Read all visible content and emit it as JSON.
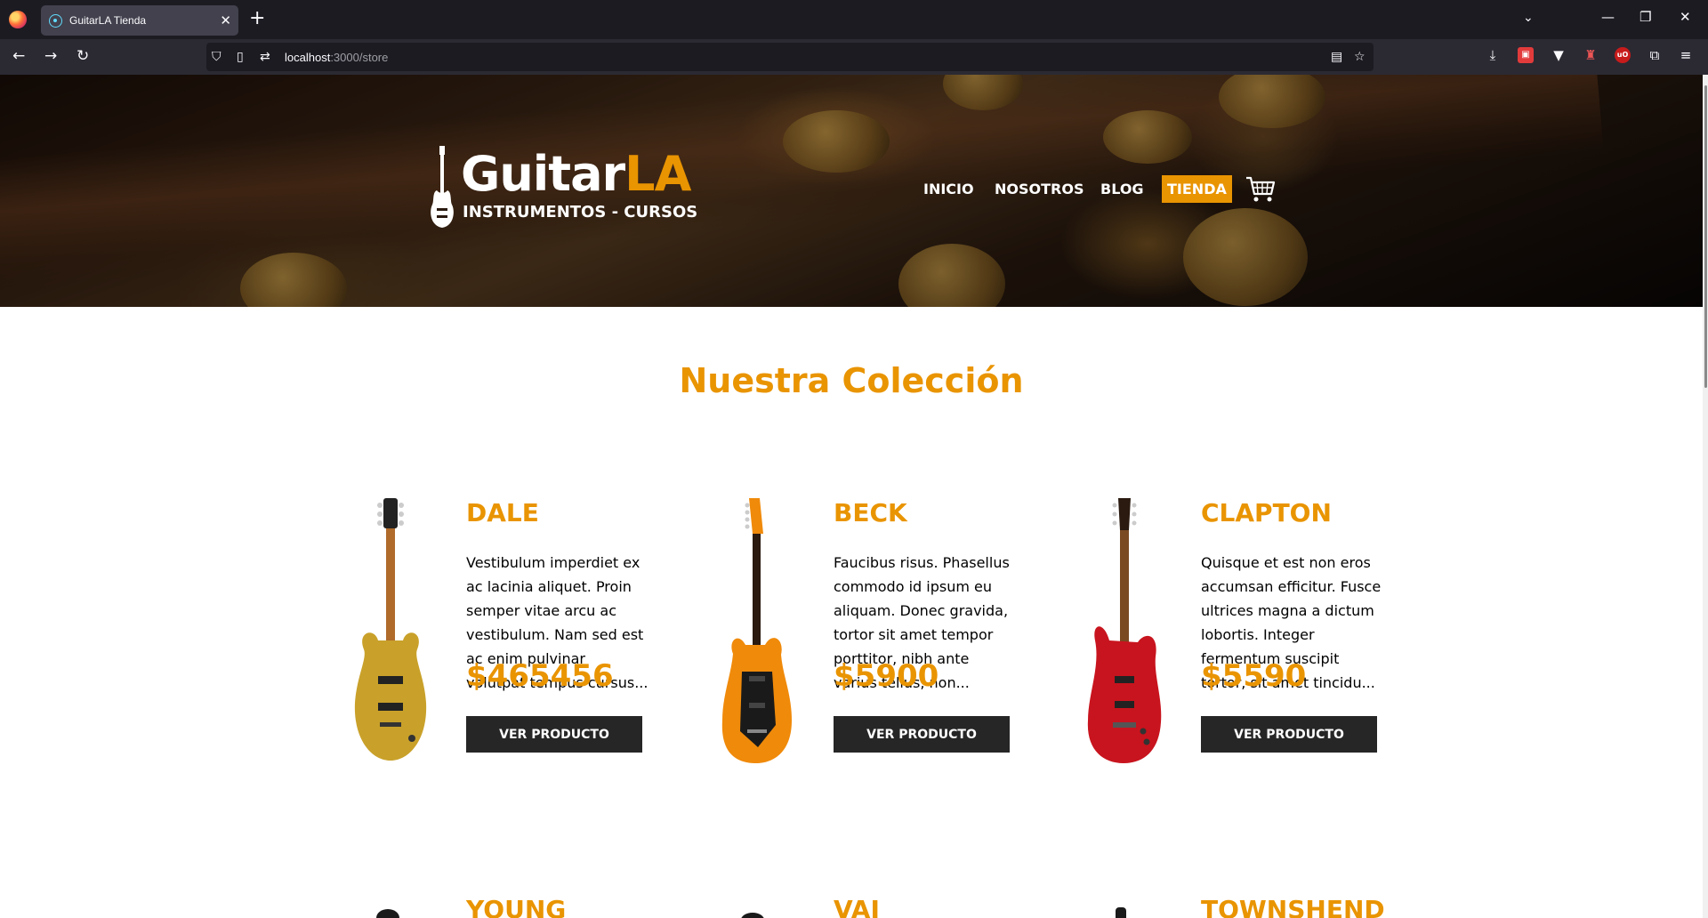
{
  "browser": {
    "tab_title": "GuitarLA Tienda",
    "url_host": "localhost",
    "url_path": ":3000/store"
  },
  "header": {
    "logo_main": "Guitar",
    "logo_accent": "LA",
    "logo_sub": "INSTRUMENTOS - CURSOS",
    "nav": [
      "INICIO",
      "NOSOTROS",
      "BLOG",
      "TIENDA"
    ],
    "active_nav": "TIENDA"
  },
  "main": {
    "title": "Nuestra Colección",
    "products": [
      {
        "name": "DALE",
        "description": "Vestibulum imperdiet ex ac lacinia aliquet. Proin semper vitae arcu ac vestibulum. Nam sed est ac enim pulvinar volutpat tempus cursus...",
        "price": "$465456",
        "button": "VER PRODUCTO",
        "color": "#c9a12a"
      },
      {
        "name": "BECK",
        "description": "Faucibus risus. Phasellus commodo id ipsum eu aliquam. Donec gravida, tortor sit amet tempor porttitor, nibh ante varius tellus, non...",
        "price": "$5900",
        "button": "VER PRODUCTO",
        "color": "#f08a0a"
      },
      {
        "name": "CLAPTON",
        "description": "Quisque et est non eros accumsan efficitur. Fusce ultrices magna a dictum lobortis. Integer fermentum suscipit tortor, sit amet tincidu...",
        "price": "$5590",
        "button": "VER PRODUCTO",
        "color": "#c8141e"
      }
    ],
    "next_row": [
      "YOUNG",
      "VAI",
      "TOWNSHEND"
    ]
  },
  "colors": {
    "accent": "#e99401",
    "button_bg": "#262626"
  }
}
